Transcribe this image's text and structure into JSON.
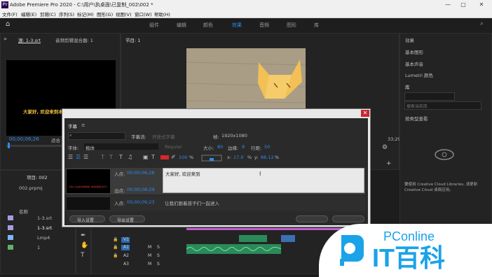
{
  "window": {
    "title": "Adobe Premiere Pro 2020 - C:\\用户\\执桌面\\已复制_002\\002 *",
    "icon": "Pr"
  },
  "window_controls": {
    "minimize": "—",
    "maximize": "▢",
    "close": "✕"
  },
  "menu": [
    "文件(F)",
    "编辑(E)",
    "剪辑(C)",
    "序列(S)",
    "标记(M)",
    "图形(G)",
    "视图(V)",
    "窗口(W)",
    "帮助(H)"
  ],
  "workspaces": [
    "组件",
    "编辑",
    "颜色",
    "效果",
    "音频",
    "图形",
    "库"
  ],
  "active_workspace": "效果",
  "source_panel": {
    "tab": "源: 1-3.srt",
    "tab2": "音频剪辑混合器: 1",
    "subtitle_preview": "大家好, 欢迎来到本",
    "timecode": "00;00;06;26",
    "fit": "适合"
  },
  "program_panel": {
    "tab": "节目: 1",
    "end_timecode": "33;29"
  },
  "right_panel": {
    "items": [
      "效果",
      "基本图形",
      "基本声音",
      "Lumetri 颜色",
      "库"
    ],
    "search_placeholder": "搜索当前库",
    "lib_label": "按类型查看",
    "cc_text": "要使用 Creative Cloud Libraries, 请更新 Creative Cloud 桌面应用。"
  },
  "project_panel": {
    "tab": "项目: 002",
    "file": "002.prproj",
    "col_name": "名称",
    "items": [
      "1-3.srt",
      "1-3.srt",
      "Lmp4",
      "1"
    ]
  },
  "caption_dialog": {
    "title": "字幕",
    "stream_label": "字幕流:",
    "stream_value": "开放式字幕",
    "frame_label": "帧:",
    "frame_value": "1920x1080",
    "font_label": "字体:",
    "font_value": "楷体",
    "style_value": "Regular",
    "size_label": "大小:",
    "size_value": "80",
    "edge_label": "边缘:",
    "edge_value": "8",
    "line_label": "行距:",
    "line_value": "50",
    "opacity": "100",
    "opacity_unit": "%",
    "x_label": "x:",
    "x_value": "17.0",
    "y_label": "y:",
    "y_value": "86.12",
    "percent": "%",
    "rows": [
      {
        "in_label": "入点:",
        "in": "00;00;06;26",
        "out_label": "出点:",
        "out": "00;00;08;29",
        "text": "大家好, 欢迎来到",
        "thumb_text": "大家好, 欢迎来到本期视频, 本期视频我们来学习"
      },
      {
        "in_label": "入点:",
        "in": "00;00;09;23",
        "text": "让我们跟着孩子们一起进入"
      }
    ],
    "import_btn": "导入设置",
    "export_btn": "导出设置"
  },
  "timeline": {
    "tracks": [
      "V1",
      "A1",
      "A2",
      "A3"
    ],
    "track_letters": [
      "M",
      "S"
    ]
  },
  "watermark": {
    "brand": "PConline",
    "sub": "IT百科"
  },
  "colors": {
    "accent": "#2d8ceb",
    "close_red": "#c8262c",
    "panel": "#232323",
    "clip_green": "#2b8a5a",
    "clip_purple": "#c35ccf"
  }
}
